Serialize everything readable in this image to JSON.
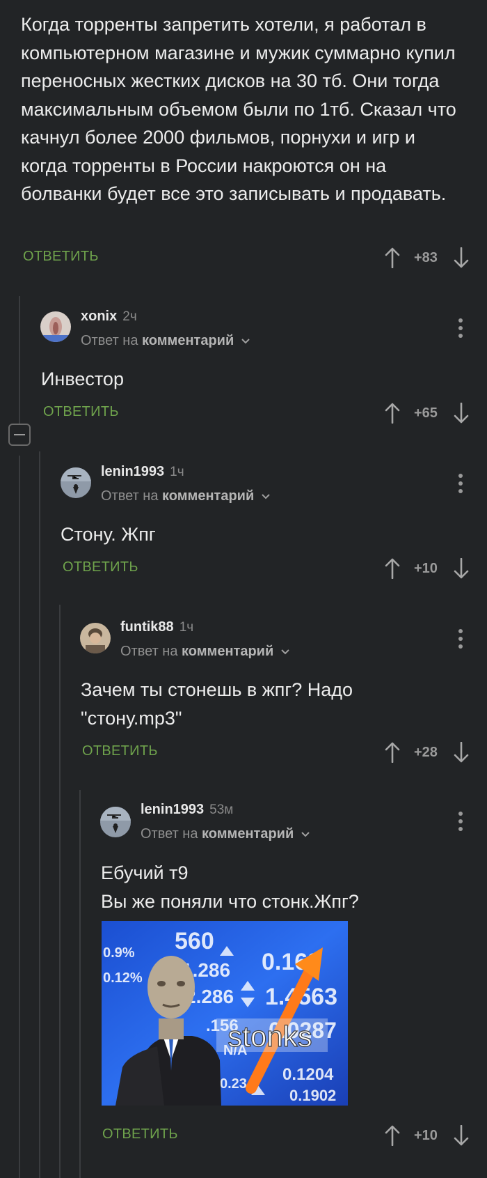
{
  "root_comment": {
    "text": "Когда торренты запретить хотели, я работал в компьютерном магазине и мужик суммарно купил переносных жестких дисков на 30 тб. Они тогда максимальным объемом были по 1тб. Сказал что качнул более 2000 фильмов, порнухи и игр и когда торренты в России накроются он на болванки будет все это записывать и продавать.",
    "reply_label": "ОТВЕТИТЬ",
    "rating": "+83"
  },
  "comments": [
    {
      "username": "xonix",
      "time": "2ч",
      "reply_to_prefix": "Ответ на",
      "reply_to_target": "комментарий",
      "text_lines": [
        "Инвестор"
      ],
      "reply_label": "ОТВЕТИТЬ",
      "rating": "+65"
    },
    {
      "username": "lenin1993",
      "time": "1ч",
      "reply_to_prefix": "Ответ на",
      "reply_to_target": "комментарий",
      "text_lines": [
        "Стону. Жпг"
      ],
      "reply_label": "ОТВЕТИТЬ",
      "rating": "+10"
    },
    {
      "username": "funtik88",
      "time": "1ч",
      "reply_to_prefix": "Ответ на",
      "reply_to_target": "комментарий",
      "text_lines": [
        "Зачем ты стонешь в жпг? Надо",
        "\"стону.mp3\""
      ],
      "reply_label": "ОТВЕТИТЬ",
      "rating": "+28"
    },
    {
      "username": "lenin1993",
      "time": "53м",
      "reply_to_prefix": "Ответ на",
      "reply_to_target": "комментарий",
      "text_lines": [
        "Ебучий т9",
        "Вы же поняли что стонк.Жпг?"
      ],
      "reply_label": "ОТВЕТИТЬ",
      "rating": "+10",
      "image": {
        "caption": "stonks",
        "ticker_values": [
          "560",
          "0.168",
          "1.4563",
          "2.286",
          "1.286",
          "0.0287",
          "0.1204",
          "0.1902",
          ".156",
          "0.234",
          "N/A",
          "0.9%",
          "0.12%"
        ]
      }
    }
  ],
  "colors": {
    "background": "#222426",
    "reply_green": "#6fa34c",
    "muted": "#8f8f8f",
    "thread_line": "#3a3c3f"
  },
  "icons": [
    "upvote-arrow-icon",
    "downvote-arrow-icon",
    "more-dots-icon",
    "collapse-minus-icon",
    "chevron-down-icon"
  ]
}
